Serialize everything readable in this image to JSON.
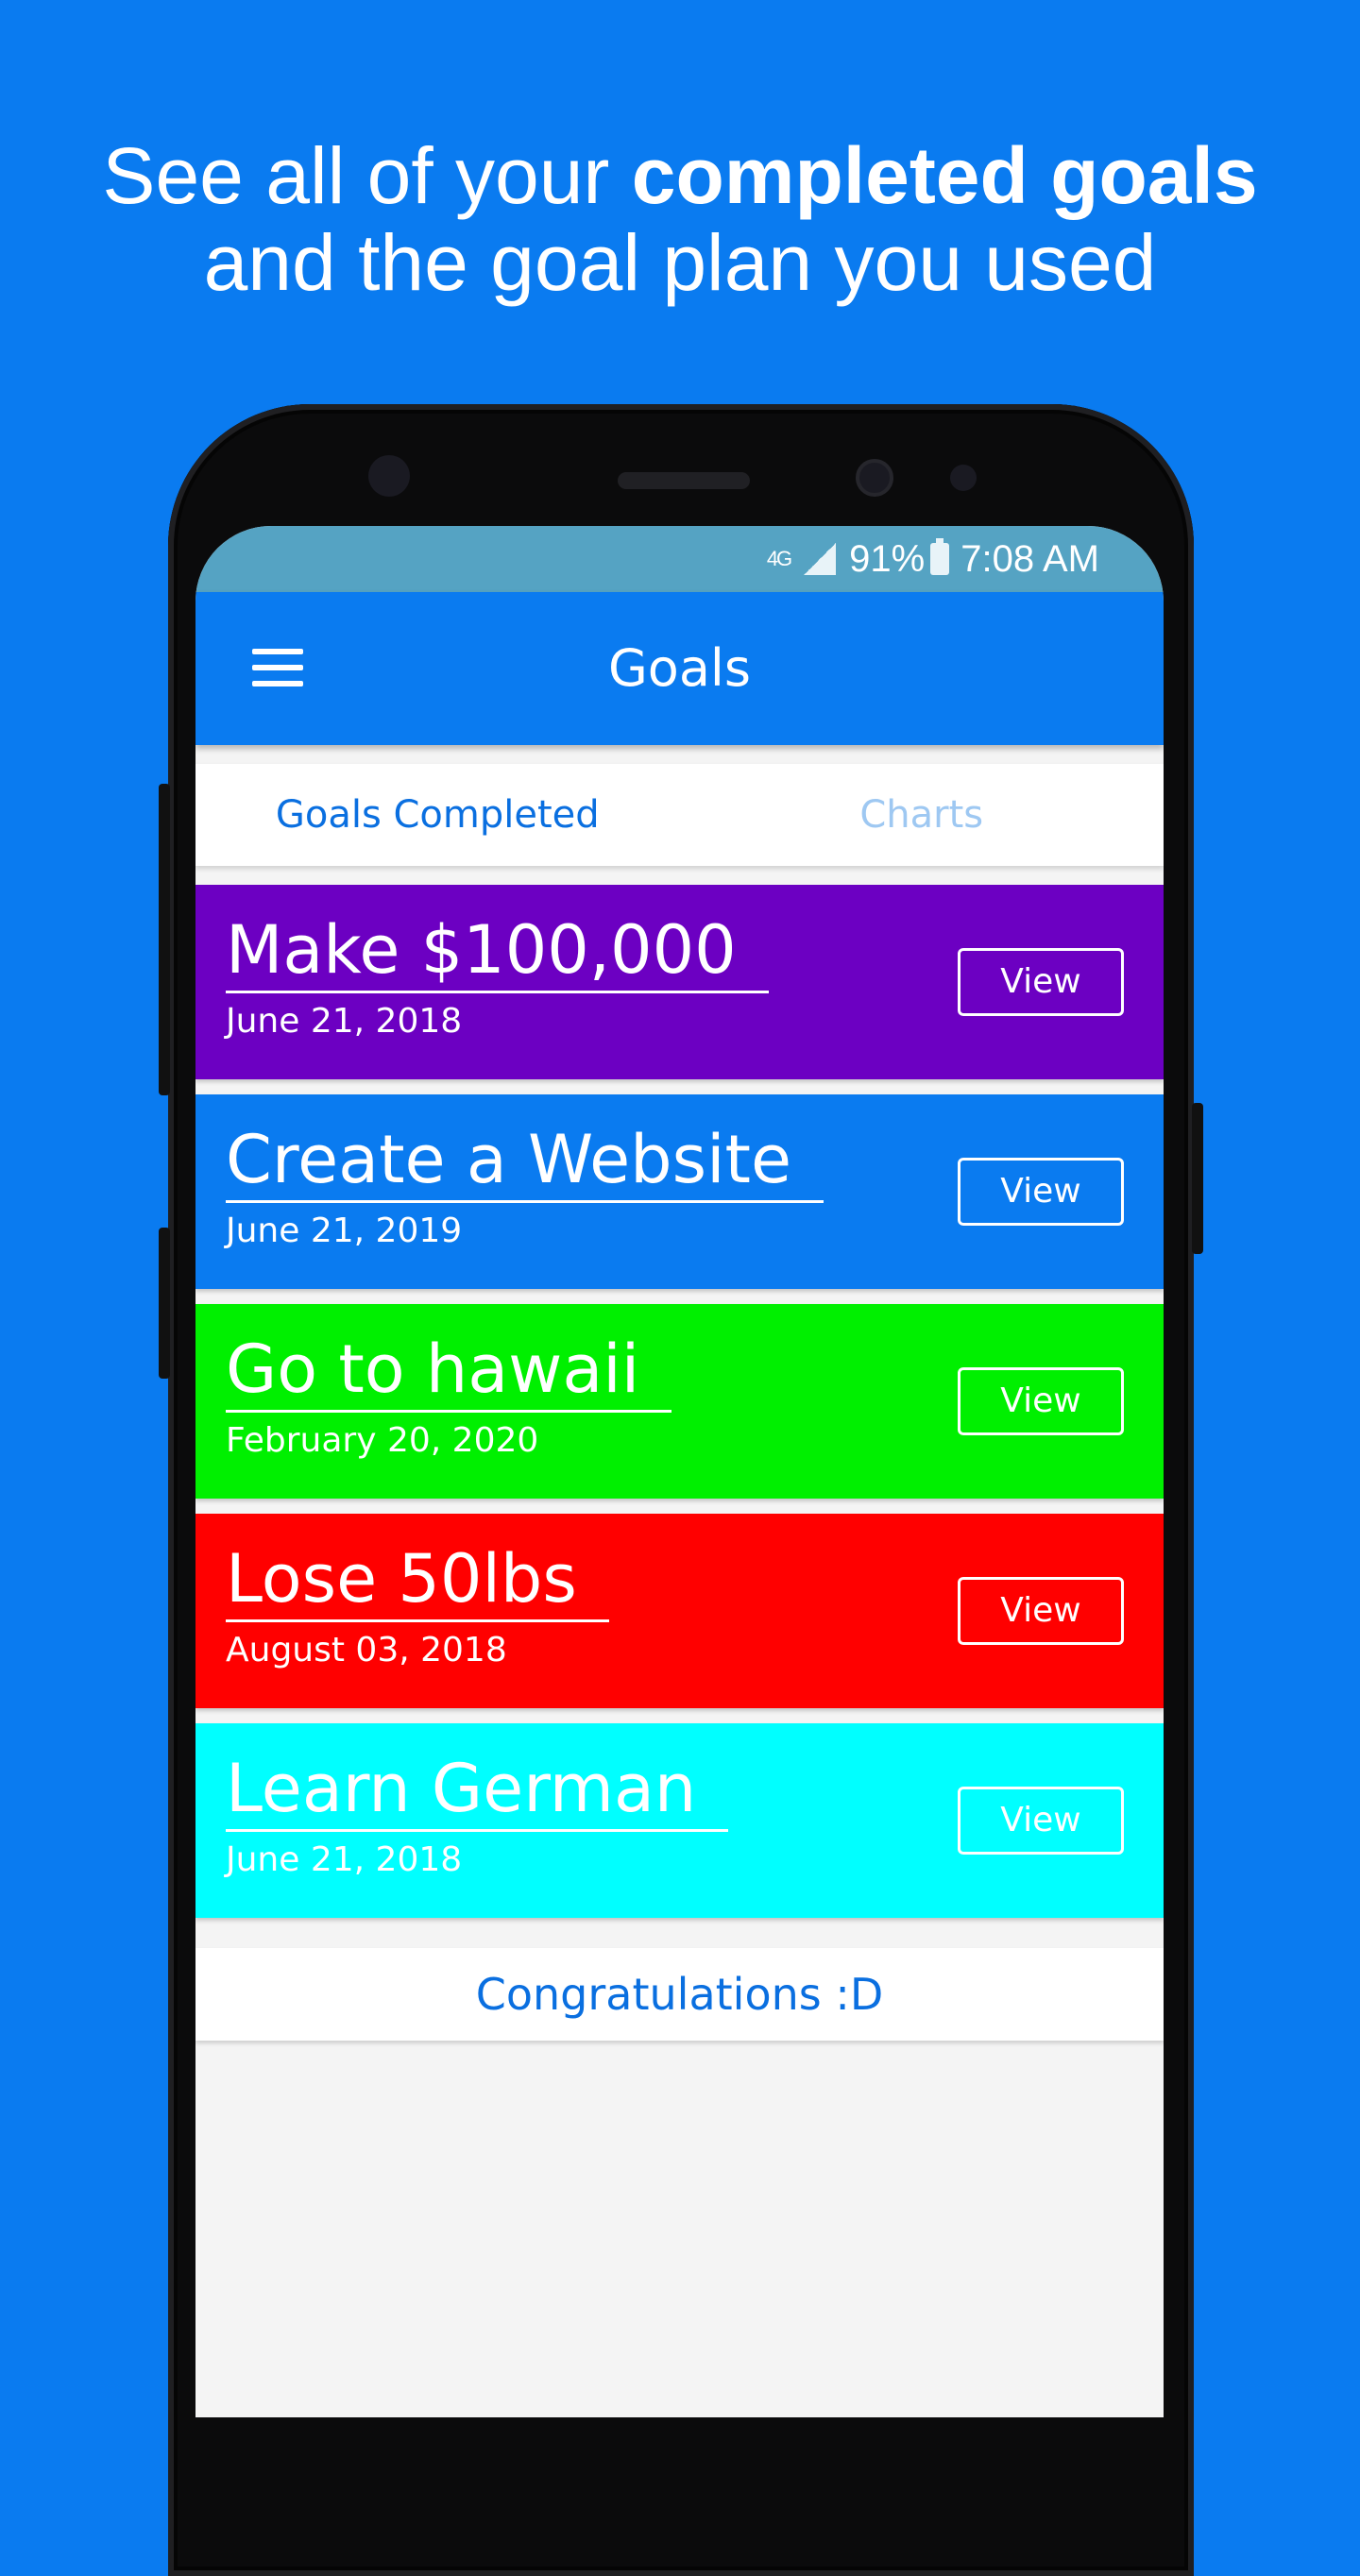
{
  "headline": {
    "line1_prefix": "See all of your ",
    "line1_bold": "completed goals",
    "line2": "and the goal plan you used"
  },
  "statusbar": {
    "network": "4G",
    "battery": "91%",
    "time": "7:08 AM"
  },
  "toolbar": {
    "title": "Goals",
    "menu_icon": "hamburger-menu-icon"
  },
  "tabs": [
    {
      "label": "Goals Completed",
      "active": true
    },
    {
      "label": "Charts",
      "active": false
    }
  ],
  "goals": [
    {
      "title": "Make $100,000",
      "date": "June 21, 2018",
      "button": "View",
      "color": "#6c00c2"
    },
    {
      "title": "Create a Website",
      "date": "June 21, 2019",
      "button": "View",
      "color": "#0a7bf0"
    },
    {
      "title": "Go to hawaii",
      "date": "February 20, 2020",
      "button": "View",
      "color": "#00f000"
    },
    {
      "title": "Lose 50lbs",
      "date": "August 03, 2018",
      "button": "View",
      "color": "#ff0000"
    },
    {
      "title": "Learn German",
      "date": "June 21, 2018",
      "button": "View",
      "color": "#00ffff"
    }
  ],
  "footer_message": "Congratulations :D",
  "colors": {
    "background": "#0a7bf0",
    "accent": "#0a6fe0",
    "statusbar": "#55a3c3"
  }
}
